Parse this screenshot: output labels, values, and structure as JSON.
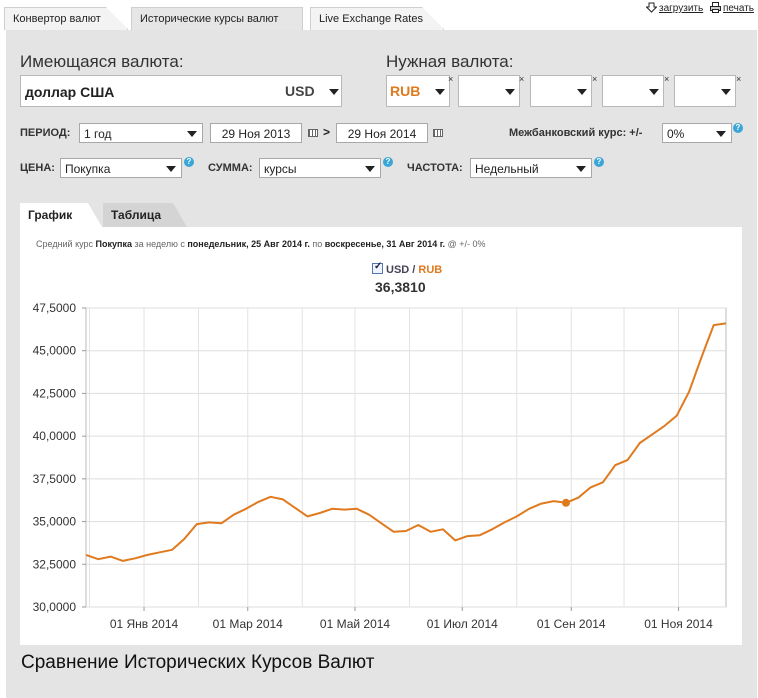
{
  "top_tabs": [
    {
      "label": "Конвертор валют",
      "active": false
    },
    {
      "label": "Исторические курсы валют",
      "active": true
    },
    {
      "label": "Live Exchange Rates",
      "active": false
    }
  ],
  "top_links": {
    "download": "загрузить",
    "print": "печать"
  },
  "have_currency": {
    "label": "Имеющаяся валюта:",
    "name": "доллар США",
    "code": "USD"
  },
  "need_currency": {
    "label": "Нужная валюта:",
    "code": "RUB",
    "accent": "#e07a1f"
  },
  "period": {
    "label": "ПЕРИОД:",
    "value": "1 год",
    "date_from": "29 Ноя 2013",
    "separator": ">",
    "date_to": "29 Ноя 2014"
  },
  "interbank": {
    "label": "Межбанковский курс: +/-",
    "value": "0%"
  },
  "price": {
    "label": "ЦЕНА:",
    "value": "Покупка"
  },
  "amount": {
    "label": "СУММА:",
    "value": "курсы"
  },
  "frequency": {
    "label": "ЧАСТОТА:",
    "value": "Недельный"
  },
  "chart_tabs": [
    {
      "label": "График",
      "active": true
    },
    {
      "label": "Таблица",
      "active": false
    }
  ],
  "chart_description": {
    "p1": "Средний курс ",
    "price": "Покупка",
    "p2": " за неделю с ",
    "start": "понедельник, 25 Авг 2014 г.",
    "p3": " по ",
    "end": "воскресенье, 31 Авг 2014 г.",
    "p4": " @ +/- 0%"
  },
  "legend": {
    "usd": "USD",
    "slash": " / ",
    "rub": "RUB"
  },
  "current_value": "36,3810",
  "bottom_title": "Сравнение Исторических Курсов Валют",
  "chart_data": {
    "type": "line",
    "series": [
      {
        "name": "USD / RUB",
        "color": "#e07a1f",
        "x": [
          "2013-11-29",
          "2013-12-06",
          "2013-12-13",
          "2013-12-20",
          "2013-12-27",
          "2014-01-03",
          "2014-01-10",
          "2014-01-17",
          "2014-01-24",
          "2014-01-31",
          "2014-02-07",
          "2014-02-14",
          "2014-02-21",
          "2014-02-28",
          "2014-03-07",
          "2014-03-14",
          "2014-03-21",
          "2014-03-28",
          "2014-04-04",
          "2014-04-11",
          "2014-04-18",
          "2014-04-25",
          "2014-05-02",
          "2014-05-09",
          "2014-05-16",
          "2014-05-23",
          "2014-05-30",
          "2014-06-06",
          "2014-06-13",
          "2014-06-20",
          "2014-06-27",
          "2014-07-04",
          "2014-07-11",
          "2014-07-18",
          "2014-07-25",
          "2014-08-01",
          "2014-08-08",
          "2014-08-15",
          "2014-08-22",
          "2014-08-29",
          "2014-09-05",
          "2014-09-12",
          "2014-09-19",
          "2014-09-26",
          "2014-10-03",
          "2014-10-10",
          "2014-10-17",
          "2014-10-24",
          "2014-10-31",
          "2014-11-07",
          "2014-11-14",
          "2014-11-21",
          "2014-11-28"
        ],
        "y": [
          33.05,
          32.8,
          32.95,
          32.7,
          32.85,
          33.05,
          33.2,
          33.35,
          34.0,
          34.85,
          34.95,
          34.9,
          35.4,
          35.75,
          36.15,
          36.45,
          36.3,
          35.8,
          35.3,
          35.5,
          35.75,
          35.7,
          35.75,
          35.4,
          34.9,
          34.4,
          34.45,
          34.8,
          34.4,
          34.55,
          33.9,
          34.15,
          34.2,
          34.55,
          34.95,
          35.3,
          35.75,
          36.05,
          36.2,
          36.1,
          36.4,
          37.0,
          37.3,
          38.3,
          38.6,
          39.6,
          40.1,
          40.6,
          41.2,
          42.6,
          44.6,
          46.5,
          46.6
        ]
      }
    ],
    "x_tick_labels": [
      "01 Янв 2014",
      "01 Мар 2014",
      "01 Май 2014",
      "01 Июл 2014",
      "01 Сен 2014",
      "01 Ноя 2014"
    ],
    "y_tick_labels": [
      "30,0000",
      "32,5000",
      "35,0000",
      "37,5000",
      "40,0000",
      "42,5000",
      "45,0000",
      "47,5000"
    ],
    "ylim": [
      30,
      47.5
    ],
    "highlight_point": {
      "x": "2014-08-29",
      "y": 36.1
    },
    "grid": true
  }
}
